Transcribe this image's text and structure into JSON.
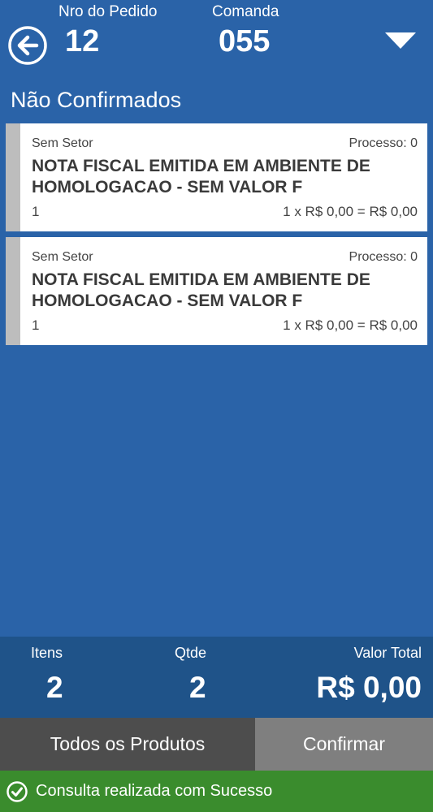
{
  "header": {
    "order_label": "Nro do Pedido",
    "order_value": "12",
    "comanda_label": "Comanda",
    "comanda_value": "055",
    "back_icon": "arrow-left-circle-icon",
    "dropdown_icon": "triangle-down-icon"
  },
  "section": {
    "title": "Não Confirmados"
  },
  "items": [
    {
      "sector": "Sem Setor",
      "process": "Processo: 0",
      "name": "NOTA FISCAL EMITIDA EM AMBIENTE DE HOMOLOGACAO - SEM VALOR F",
      "qty": "1",
      "price": "1 x R$ 0,00 = R$ 0,00"
    },
    {
      "sector": "Sem Setor",
      "process": "Processo: 0",
      "name": "NOTA FISCAL EMITIDA EM AMBIENTE DE HOMOLOGACAO - SEM VALOR F",
      "qty": "1",
      "price": "1 x R$ 0,00 = R$ 0,00"
    }
  ],
  "totals": {
    "items_label": "Itens",
    "items_value": "2",
    "qty_label": "Qtde",
    "qty_value": "2",
    "total_label": "Valor Total",
    "total_value": "R$ 0,00"
  },
  "buttons": {
    "all_products": "Todos os Produtos",
    "confirm": "Confirmar"
  },
  "status": {
    "message": "Consulta realizada com Sucesso",
    "icon": "check-circle-icon"
  },
  "colors": {
    "background": "#2a63a8",
    "totals_bar": "#1f5389",
    "button_dark": "#4d4d4d",
    "button_light": "#7f7f7f",
    "success": "#3a8c2d",
    "card_stripe": "#bdbdbd"
  }
}
